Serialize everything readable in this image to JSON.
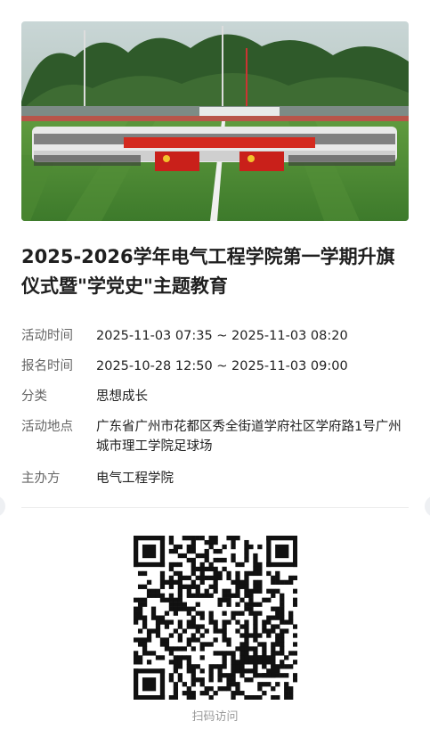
{
  "event": {
    "title": "2025-2026学年电气工程学院第一学期升旗仪式暨\"学党史\"主题教育",
    "rows": [
      {
        "label": "活动时间",
        "value": "2025-11-03 07:35 ~ 2025-11-03 08:20"
      },
      {
        "label": "报名时间",
        "value": "2025-10-28 12:50 ~ 2025-11-03 09:00"
      },
      {
        "label": "分类",
        "value": "思想成长"
      },
      {
        "label": "活动地点",
        "value": "广东省广州市花都区秀全街道学府社区学府路1号广州城市理工学院足球场"
      },
      {
        "label": "主办方",
        "value": "电气工程学院"
      }
    ]
  },
  "qr": {
    "caption": "扫码访问"
  }
}
